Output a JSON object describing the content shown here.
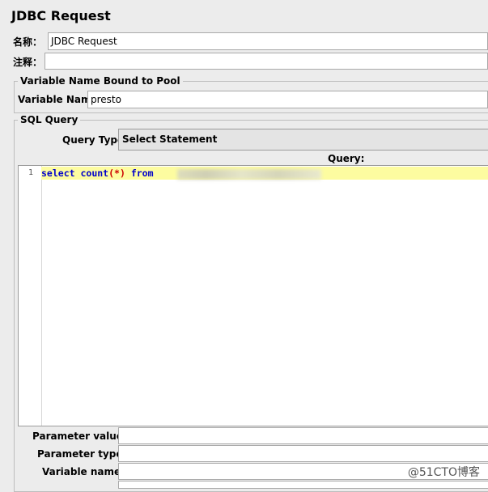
{
  "window": {
    "title": "JDBC Request"
  },
  "name_row": {
    "label": "名称：",
    "value": "JDBC Request"
  },
  "comment_row": {
    "label": "注释：",
    "value": ""
  },
  "pool_group": {
    "legend": "Variable Name Bound to Pool",
    "variable_name_label": "Variable Name:",
    "variable_name_value": "presto"
  },
  "sql_group": {
    "legend": "SQL Query",
    "query_type_label": "Query Type:",
    "query_type_value": "Select Statement",
    "query_label": "Query:",
    "editor": {
      "line_number": "1",
      "code_select": "select",
      "code_count": "count",
      "code_paren": "(*)",
      "code_from": "from"
    }
  },
  "params": {
    "values_label": "Parameter values:",
    "types_label": "Parameter types:",
    "names_label": "Variable names:"
  },
  "watermark": "@51CTO博客"
}
